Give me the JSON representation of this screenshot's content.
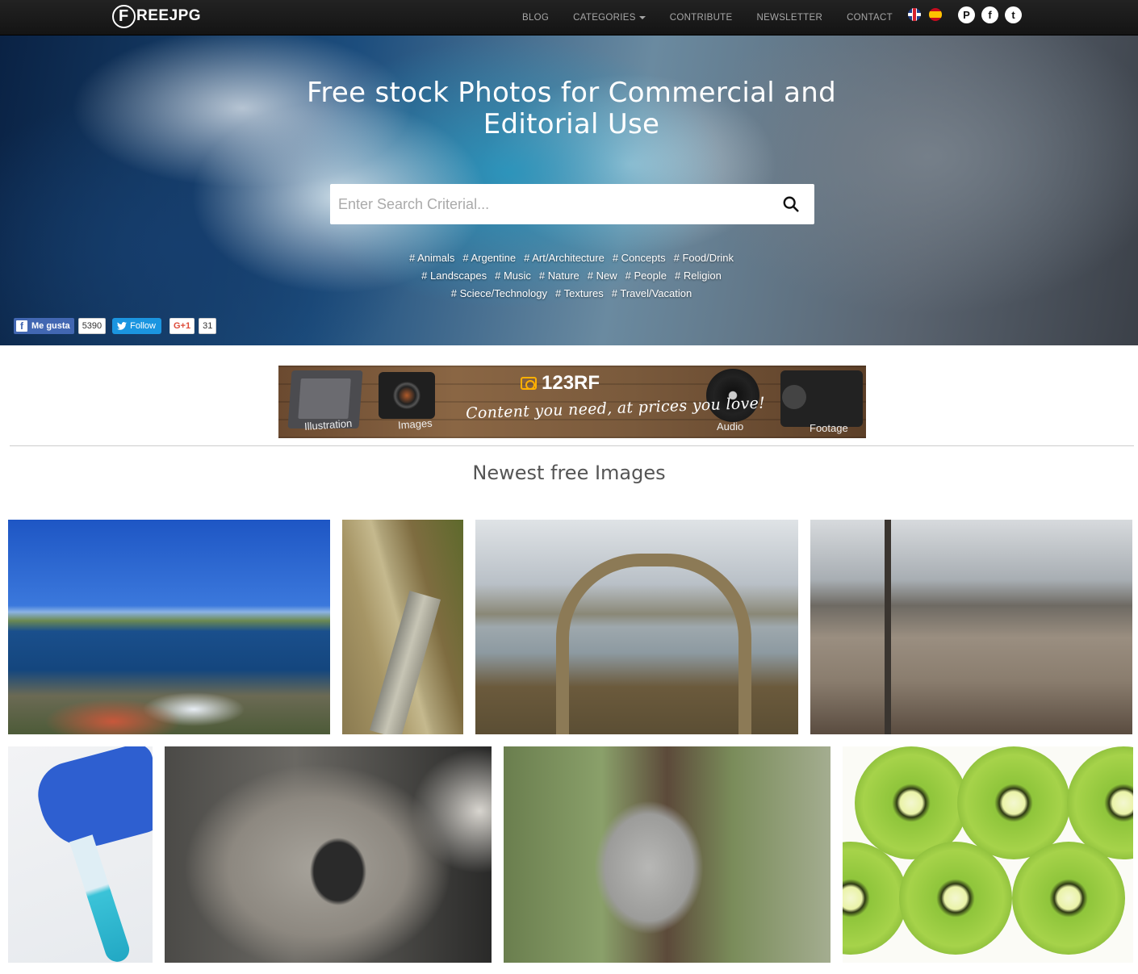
{
  "brand": {
    "logo_mark": "F",
    "logo_text": "REEJPG"
  },
  "nav": {
    "items": [
      {
        "label": "BLOG"
      },
      {
        "label": "CATEGORIES",
        "dropdown": true
      },
      {
        "label": "CONTRIBUTE"
      },
      {
        "label": "NEWSLETTER"
      },
      {
        "label": "CONTACT"
      }
    ],
    "languages": [
      "english-flag",
      "spanish-flag"
    ],
    "socials": [
      {
        "icon": "pinterest-icon",
        "glyph": "P"
      },
      {
        "icon": "facebook-icon",
        "glyph": "f"
      },
      {
        "icon": "twitter-icon",
        "glyph": "t"
      }
    ]
  },
  "hero": {
    "title": "Free stock Photos for Commercial and Editorial Use",
    "search": {
      "placeholder": "Enter Search Criterial...",
      "value": ""
    },
    "tag_lines": [
      [
        "# Animals",
        "# Argentine",
        "# Art/Architecture",
        "# Concepts",
        "# Food/Drink"
      ],
      [
        "# Landscapes",
        "# Music",
        "# Nature",
        "# New",
        "# People",
        "# Religion"
      ],
      [
        "# Sciece/Technology",
        "# Textures",
        "# Travel/Vacation"
      ]
    ],
    "social": {
      "fb_like_label": "Me gusta",
      "fb_like_count": "5390",
      "twitter_label": "Follow",
      "gplus_label": "G+1",
      "gplus_count": "31"
    }
  },
  "banner": {
    "brand": "123RF",
    "tagline": "Content you need, at prices you love!",
    "labels": [
      "Illustration",
      "Images",
      "Audio",
      "Footage"
    ]
  },
  "section": {
    "title": "Newest free Images"
  },
  "gallery": [
    {
      "name": "lake-town-photo"
    },
    {
      "name": "reed-boat-photo"
    },
    {
      "name": "reed-arch-photo"
    },
    {
      "name": "city-hillside-photo"
    },
    {
      "name": "test-tube-photo"
    },
    {
      "name": "koala-closeup-photo"
    },
    {
      "name": "koalas-tree-photo"
    },
    {
      "name": "kiwi-slices-photo"
    }
  ],
  "colors": {
    "navbar_bg": "#1b1b1b",
    "nav_text": "#a7a7a7",
    "facebook": "#4267b2",
    "twitter": "#1b95e0",
    "gplus": "#dd4b39"
  }
}
